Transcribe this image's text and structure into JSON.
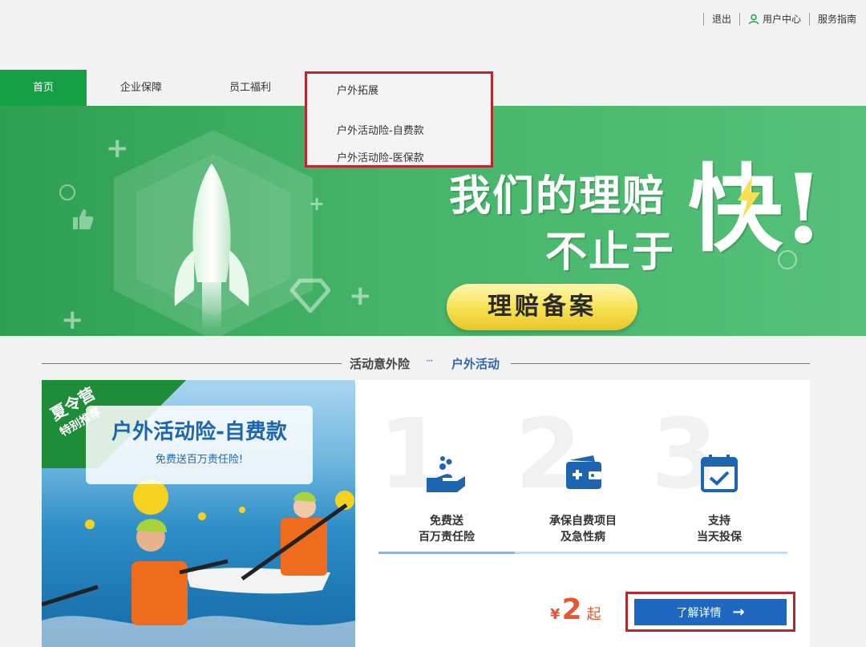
{
  "topbar": {
    "logout": "退出",
    "user_center": "用户中心",
    "service_guide": "服务指南"
  },
  "nav": {
    "items": [
      "首页",
      "企业保障",
      "员工福利",
      "户外拓展"
    ],
    "active": "首页"
  },
  "dropdown": {
    "title": "户外拓展",
    "items": [
      "户外活动险-自费款",
      "户外活动险-医保款"
    ]
  },
  "banner": {
    "line1": "我们的理赔",
    "line2": "不止于",
    "emphasis": "快!",
    "button": "理赔备案",
    "colors": {
      "green": "#45b468",
      "yellow": "#f6e04f"
    }
  },
  "section": {
    "title": "活动意外险",
    "divider": "···",
    "subtitle": "户外活动"
  },
  "product": {
    "badge_line1": "夏令营",
    "badge_line2": "特别推荐",
    "image_title": "户外活动险-自费款",
    "image_subtitle": "免费送百万责任险!",
    "steps": [
      {
        "num": "1",
        "icon": "hand-coins-icon",
        "line1": "免费送",
        "line2": "百万责任险"
      },
      {
        "num": "2",
        "icon": "medical-wallet-icon",
        "line1": "承保自费项目",
        "line2": "及急性病"
      },
      {
        "num": "3",
        "icon": "calendar-check-icon",
        "line1": "支持",
        "line2": "当天投保"
      }
    ],
    "price_currency": "¥",
    "price_value": "2",
    "price_suffix": "起",
    "detail_button": "了解详情",
    "accent_color": "#1e68c1"
  }
}
